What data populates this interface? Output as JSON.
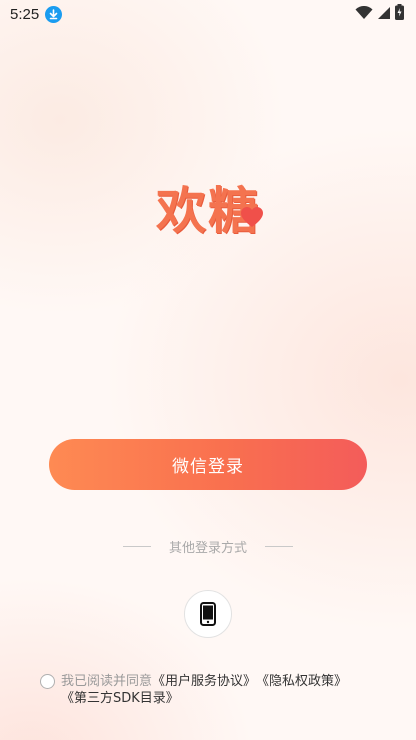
{
  "status_bar": {
    "time": "5:25",
    "icons": [
      "download-icon",
      "wifi-icon",
      "signal-icon",
      "battery-icon"
    ]
  },
  "logo": {
    "text": "欢糖"
  },
  "login": {
    "wechat_label": "微信登录",
    "other_methods_label": "其他登录方式",
    "phone_icon": "phone-icon"
  },
  "agreement": {
    "prefix": "我已阅读并同意",
    "user_agreement": "《用户服务协议》",
    "privacy_policy": "《隐私权政策》",
    "sdk_list": "《第三方SDK目录》"
  },
  "colors": {
    "accent": "#f9704f",
    "gradient_start": "#fe8a53",
    "gradient_end": "#f45c5a",
    "download_badge": "#1a9cf0"
  }
}
